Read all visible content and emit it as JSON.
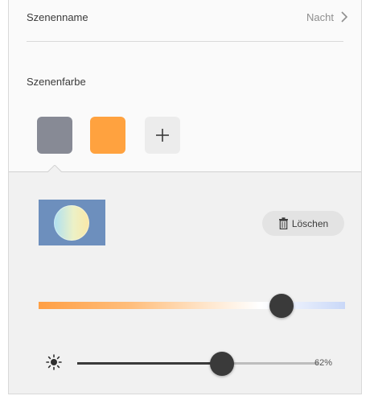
{
  "scene": {
    "name_label": "Szenenname",
    "name_value": "Nacht",
    "color_label": "Szenenfarbe"
  },
  "swatches": [
    {
      "color": "#878a95"
    },
    {
      "color": "#ffa23f"
    }
  ],
  "add_symbol": "+",
  "editor": {
    "delete_label": "Löschen",
    "color_slider_position": 0.82,
    "brightness_value": 0.62,
    "brightness_text": "62%"
  },
  "icons": {
    "chevron": "chevron-right-icon",
    "trash": "trash-icon",
    "sun": "sun-icon",
    "plus": "plus-icon"
  }
}
